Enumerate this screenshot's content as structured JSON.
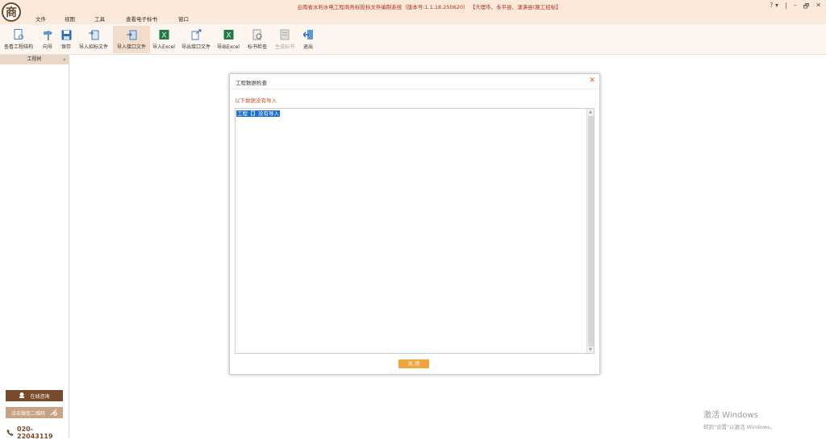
{
  "app": {
    "logo_char": "商",
    "title": "云南省水利水电工程商务标投标文件编制系统（版本号:1.1.18.250620） 【大理市、永平县、漾濞县(施工招标】"
  },
  "menu": [
    "文件",
    "视图",
    "工具",
    "查看电子标书",
    "窗口"
  ],
  "window_controls": {
    "help": "? ▾",
    "sep": "|",
    "minimize": "–",
    "restore": "🗗",
    "close": "✕"
  },
  "toolbar": [
    {
      "label": "查看工程结构",
      "icon": "doc-search-icon"
    },
    {
      "label": "向导",
      "icon": "signpost-icon"
    },
    {
      "label": "保存",
      "icon": "save-icon"
    },
    {
      "label": "导入招标文件",
      "icon": "import-doc-icon"
    },
    {
      "label": "导入接口文件",
      "icon": "import-interface-icon",
      "active": true
    },
    {
      "label": "导入Excel",
      "icon": "excel-icon"
    },
    {
      "label": "导出接口文件",
      "icon": "export-interface-icon"
    },
    {
      "label": "导出Excel",
      "icon": "excel-export-icon"
    },
    {
      "label": "标书检查",
      "icon": "check-doc-icon"
    },
    {
      "label": "生成标书",
      "icon": "generate-doc-icon",
      "disabled": true
    },
    {
      "label": "退出",
      "icon": "exit-icon"
    }
  ],
  "sidebar": {
    "header": "工程树",
    "collapse": "»",
    "online_consult": "在线咨询",
    "wechat_qr": "点击微信二维码",
    "phone": "020-22043119"
  },
  "dialog": {
    "title": "工程数据检查",
    "close": "✕",
    "message": "以下数据没有导入",
    "items": [
      "工程【】没有导入"
    ],
    "ok_button": "关 闭"
  },
  "watermark": {
    "line1": "激活 Windows",
    "line2": "转到\"设置\"以激活 Windows。"
  },
  "colors": {
    "titlebar_bg": "#fce9d9",
    "accent_brown": "#7a4a2a",
    "button_orange": "#f2a33a",
    "selection_blue": "#1a6fd0"
  }
}
